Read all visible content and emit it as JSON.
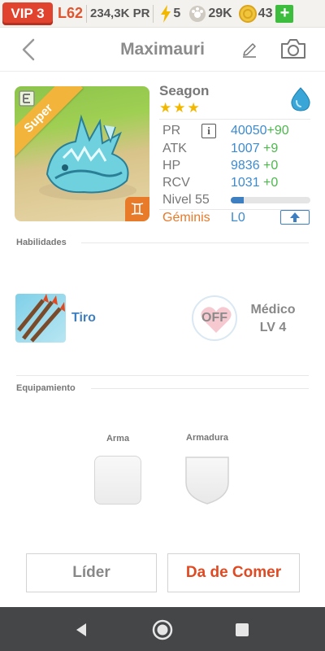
{
  "status_bar": {
    "vip": "VIP 3",
    "level": "L62",
    "power": "234,3K PR",
    "energy": "5",
    "food": "29K",
    "coins": "43",
    "plus": "+"
  },
  "header": {
    "title": "Maximauri"
  },
  "monster": {
    "rarity": "Super",
    "species": "Seagon",
    "stars": [
      "★",
      "★",
      "★"
    ],
    "element": "water",
    "stats": {
      "pr_label": "PR",
      "pr_value": "40050",
      "pr_bonus": "+90",
      "atk_label": "ATK",
      "atk_value": "1007",
      "atk_bonus": "+9",
      "hp_label": "HP",
      "hp_value": "9836",
      "hp_bonus": "+0",
      "rcv_label": "RCV",
      "rcv_value": "1031",
      "rcv_bonus": "+0",
      "level_label": "Nivel 55",
      "level_progress": 0.16,
      "sign_label": "Géminis",
      "sign_level": "L0",
      "info_glyph": "i",
      "zodiac_glyph": "♊"
    }
  },
  "abilities": {
    "section_title": "Habilidades",
    "skill_name": "Tiro",
    "leader_state": "OFF",
    "leader_name": "Médico",
    "leader_level": "LV 4"
  },
  "equipment": {
    "section_title": "Equipamiento",
    "weapon_label": "Arma",
    "armor_label": "Armadura"
  },
  "actions": {
    "leader_button": "Líder",
    "feed_button": "Da de Comer"
  },
  "colors": {
    "accent_blue": "#3d8bd0",
    "bonus_green": "#4cb84c",
    "feed_red": "#e04a22",
    "vip_red": "#e0432e"
  }
}
